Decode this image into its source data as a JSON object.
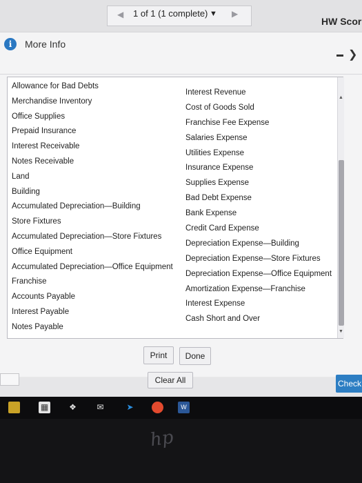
{
  "topbar": {
    "pager_label": "1 of 1 (1 complete)",
    "hw_score": "HW Scor"
  },
  "dialog": {
    "title": "More Info",
    "info_glyph": "i",
    "minimize_icon": "minimize-icon",
    "expand_icon": "expand-icon",
    "left_accounts": [
      "Allowance for Bad Debts",
      "Merchandise Inventory",
      "Office Supplies",
      "Prepaid Insurance",
      "Interest Receivable",
      "Notes Receivable",
      "Land",
      "Building",
      "Accumulated Depreciation—Building",
      "Store Fixtures",
      "Accumulated Depreciation—Store Fixtures",
      "Office Equipment",
      "Accumulated Depreciation—Office Equipment",
      "Franchise",
      "Accounts Payable",
      "Interest Payable",
      "Notes Payable"
    ],
    "right_accounts": [
      "Interest Revenue",
      "Cost of Goods Sold",
      "Franchise Fee Expense",
      "Salaries Expense",
      "Utilities Expense",
      "Insurance Expense",
      "Supplies Expense",
      "Bad Debt Expense",
      "Bank Expense",
      "Credit Card Expense",
      "Depreciation Expense—Building",
      "Depreciation Expense—Store Fixtures",
      "Depreciation Expense—Office Equipment",
      "Amortization Expense—Franchise",
      "Interest Expense",
      "Cash Short and Over"
    ],
    "print_label": "Print",
    "done_label": "Done"
  },
  "footer": {
    "clear_all_label": "Clear All",
    "check_label": "Check"
  },
  "colors": {
    "accent_blue": "#2d7ec3",
    "info_blue": "#2a78c2"
  }
}
